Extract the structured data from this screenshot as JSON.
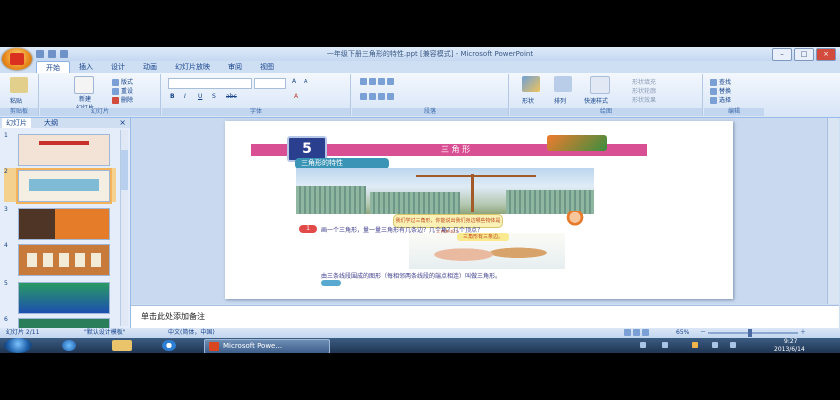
{
  "window": {
    "title": "一年级下册三角形的特性.ppt [兼容模式] - Microsoft PowerPoint",
    "controls": [
      "–",
      "□",
      "×"
    ]
  },
  "ribbon": {
    "tabs": [
      "开始",
      "插入",
      "设计",
      "动画",
      "幻灯片放映",
      "审阅",
      "视图"
    ],
    "active_tab": "开始",
    "groups": [
      "剪贴板",
      "幻灯片",
      "字体",
      "段落",
      "绘图",
      "编辑"
    ],
    "clipboard": {
      "paste": "粘贴"
    },
    "slides": {
      "new_slide": "新建\n幻灯片",
      "layout": "版式",
      "reset": "重设",
      "delete": "删除"
    },
    "font": {
      "size_buttons": [
        "A",
        "A"
      ],
      "format_buttons": [
        "B",
        "I",
        "U",
        "S",
        "abc",
        "A"
      ]
    },
    "drawing": {
      "shapes": "形状",
      "arrange": "排列",
      "quick_styles": "快速样式",
      "fill": "形状填充",
      "outline": "形状轮廓",
      "effects": "形状效果"
    },
    "editing": {
      "find": "查找",
      "replace": "替换",
      "select": "选择"
    }
  },
  "left_pane": {
    "tabs": [
      "幻灯片",
      "大纲"
    ],
    "close": "×",
    "thumbnails": [
      {
        "num": "1",
        "colors": [
          "#f3e3d6",
          "#c9302c"
        ]
      },
      {
        "num": "2",
        "colors": [
          "#f4efe2",
          "#7fbbd4"
        ]
      },
      {
        "num": "3",
        "colors": [
          "#4e3526",
          "#e57c2a"
        ]
      },
      {
        "num": "4",
        "colors": [
          "#c77a3a",
          "#f3ead8"
        ]
      },
      {
        "num": "5",
        "colors": [
          "#2a9a63",
          "#1d4fb0"
        ]
      },
      {
        "num": "6",
        "colors": [
          "#2a7f5a",
          "#d8ecd0"
        ]
      }
    ],
    "selected_index": 1
  },
  "slide": {
    "lesson_number": "5",
    "chapter_title": "三 角 形",
    "section_title": "三角形的特性",
    "speech_bubble": "我们学过三角形，你能说出我们身边哪些物体是三角形吗？",
    "question_mark": "1",
    "question": "画一个三角形，量一量三角形有几条边？几个角？几个顶点？",
    "answer_tag": "三角形有三条边。",
    "definition": "由三条线段围成的图形（每相邻两条线段的端点相连）叫做三角形。"
  },
  "notes": {
    "placeholder": "单击此处添加备注"
  },
  "statusbar": {
    "slide_info": "幻灯片 2/11",
    "theme": "\"默认设计模板\"",
    "language": "中文(简体，中国)",
    "zoom": "65%",
    "zoom_minus": "－",
    "zoom_plus": "＋"
  },
  "taskbar": {
    "app_label": "Microsoft Powe...",
    "time": "9:27",
    "date": "2013/6/14"
  }
}
